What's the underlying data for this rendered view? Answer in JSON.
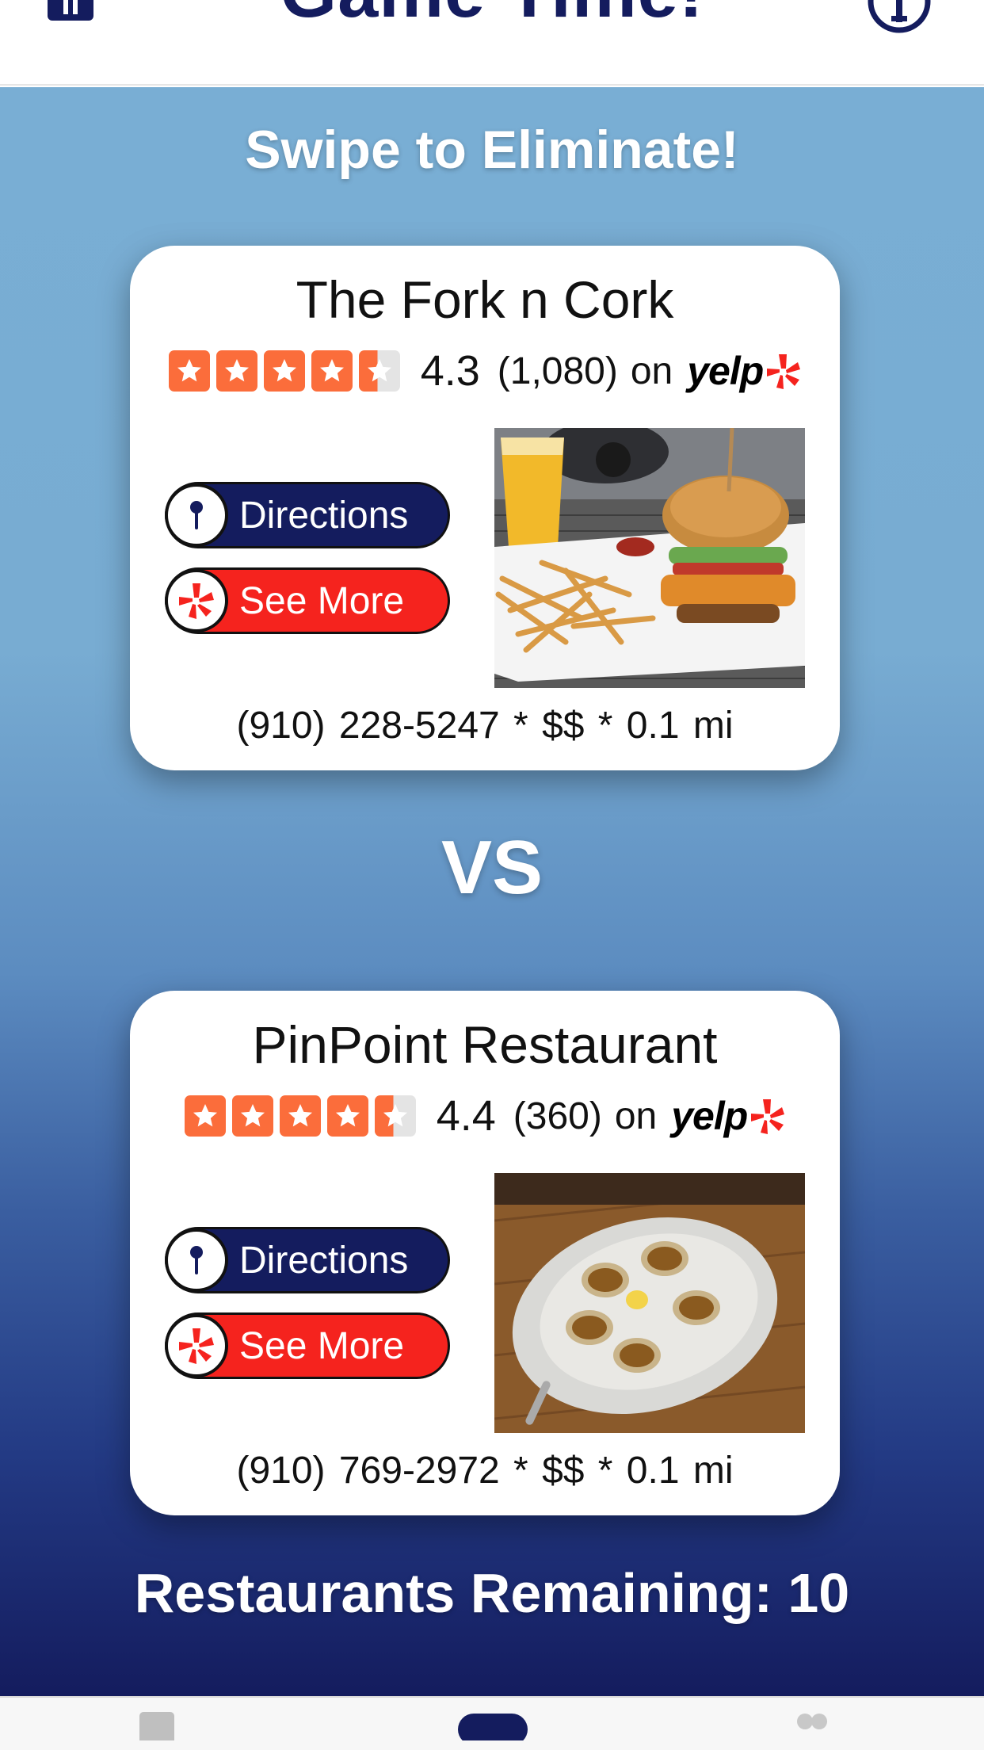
{
  "header": {
    "title": "Game Time!",
    "left_icon": "trash-icon",
    "right_icon": "info-icon"
  },
  "game": {
    "instruction": "Swipe to Eliminate!",
    "vs_label": "VS",
    "remaining_label": "Restaurants Remaining: 10"
  },
  "colors": {
    "navy": "#141c5e",
    "yelp_red": "#f5231e",
    "star_orange": "#fb6d3b",
    "sky_blue": "#79aed4"
  },
  "restaurants": [
    {
      "name": "The Fork n Cork",
      "rating_stars": 4.5,
      "rating": "4.3",
      "reviews": "(1,080)",
      "on": "on",
      "yelp": "yelp",
      "directions_label": "Directions",
      "see_more_label": "See More",
      "photo": "burger-and-fries-photo",
      "footer": "(910) 228-5247  *  $$  *  0.1 mi"
    },
    {
      "name": "PinPoint Restaurant",
      "rating_stars": 4.5,
      "rating": "4.4",
      "reviews": "(360)",
      "on": "on",
      "yelp": "yelp",
      "directions_label": "Directions",
      "see_more_label": "See More",
      "photo": "baked-oysters-photo",
      "footer": "(910) 769-2972  *  $$  *  0.1 mi"
    }
  ],
  "tab_bar": {
    "icons": [
      "cards-icon",
      "game-icon",
      "heart-icon"
    ]
  }
}
